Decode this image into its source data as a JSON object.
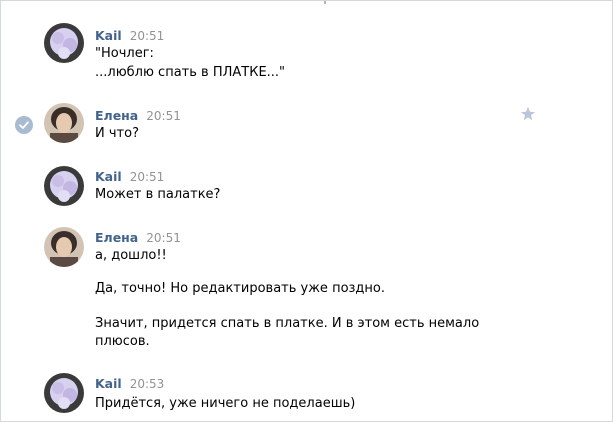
{
  "messages": [
    {
      "author": "Kail",
      "time": "20:51",
      "avatar": "kail-avatar",
      "lines": [
        "\"Ночлег:",
        "...люблю спать в ПЛАТКЕ...\""
      ]
    },
    {
      "author": "Елена",
      "time": "20:51",
      "avatar": "elena-avatar",
      "lines": [
        "И что?"
      ],
      "selected": true,
      "starred": true
    },
    {
      "author": "Kail",
      "time": "20:51",
      "avatar": "kail-avatar",
      "lines": [
        "Может в палатке?"
      ]
    },
    {
      "author": "Елена",
      "time": "20:51",
      "avatar": "elena-avatar",
      "lines": [
        "а, дошло!!",
        "Да, точно! Но редактировать уже поздно.",
        "Значит, придется спать в платке. И в этом есть немало",
        "плюсов."
      ]
    },
    {
      "author": "Kail",
      "time": "20:53",
      "avatar": "kail-avatar",
      "lines": [
        "Придётся, уже ничего не поделаешь)"
      ]
    }
  ],
  "colors": {
    "author": "#42648b",
    "time": "#939393",
    "text": "#000000",
    "check": "#a9bbd1",
    "star": "#b8c7da",
    "border": "#d3d9de"
  }
}
